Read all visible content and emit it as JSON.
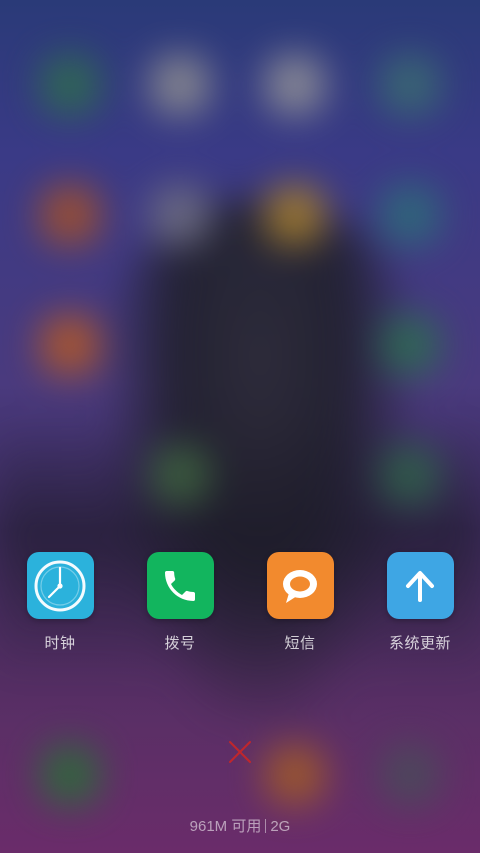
{
  "recents": {
    "apps": [
      {
        "label": "时钟",
        "icon": "clock-icon",
        "color": "#2bb2dc"
      },
      {
        "label": "拨号",
        "icon": "phone-icon",
        "color": "#12b55e"
      },
      {
        "label": "短信",
        "icon": "message-icon",
        "color": "#f28a2e"
      },
      {
        "label": "系统更新",
        "icon": "update-arrow-icon",
        "color": "#3ea6e4"
      }
    ],
    "close_icon": "close-icon",
    "close_color": "#c0262c"
  },
  "memory": {
    "available": "961M 可用",
    "total": "2G"
  }
}
